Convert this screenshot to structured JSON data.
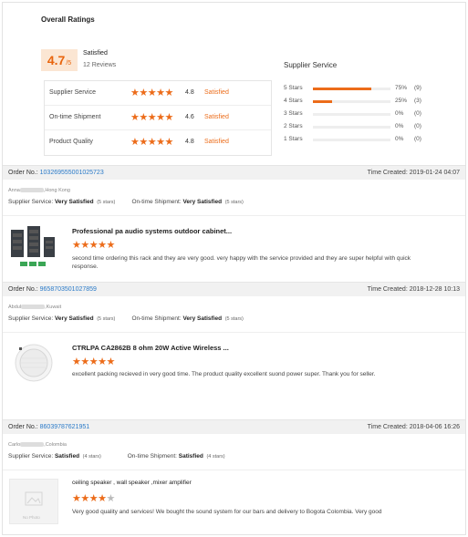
{
  "overall": {
    "title": "Overall Ratings",
    "score": "4.7",
    "score_denominator": "/5",
    "status": "Satisfied",
    "reviews": "12 Reviews"
  },
  "ratings": [
    {
      "label": "Supplier Service",
      "stars": "★★★★★",
      "score": "4.8",
      "status": "Satisfied"
    },
    {
      "label": "On-time Shipment",
      "stars": "★★★★★",
      "score": "4.6",
      "status": "Satisfied"
    },
    {
      "label": "Product Quality",
      "stars": "★★★★★",
      "score": "4.8",
      "status": "Satisfied"
    }
  ],
  "supplier_service": {
    "title": "Supplier Service",
    "rows": [
      {
        "label": "5 Stars",
        "pct_text": "75%",
        "pct": 0.75,
        "count": "(9)"
      },
      {
        "label": "4 Stars",
        "pct_text": "25%",
        "pct": 0.25,
        "count": "(3)"
      },
      {
        "label": "3 Stars",
        "pct_text": "0%",
        "pct": 0,
        "count": "(0)"
      },
      {
        "label": "2 Stars",
        "pct_text": "0%",
        "pct": 0,
        "count": "(0)"
      },
      {
        "label": "1 Stars",
        "pct_text": "0%",
        "pct": 0,
        "count": "(0)"
      }
    ]
  },
  "accent_color": "#ec6c1a",
  "link_color": "#2a7ac8",
  "orders": [
    {
      "order_label": "Order No.:",
      "order_no": "103269555001025723",
      "time_label": "Time Created:",
      "time": "2019-01-24 04:07",
      "buyer_prefix": "Anna",
      "buyer_location": "Hong Kong",
      "supplier_service_label": "Supplier Service:",
      "supplier_service_value": "Very Satisfied",
      "supplier_service_stars": "(5 stars)",
      "shipment_label": "On-time Shipment:",
      "shipment_value": "Very Satisfied",
      "shipment_stars": "(5 stars)",
      "product_name": "Professional pa audio systems outdoor cabinet...",
      "rating_stars": "★★★★★",
      "rating_off": "",
      "review": "second time ordering this rack and they are very good. very happy with the service provided and they are super helpful with quick response."
    },
    {
      "order_label": "Order No.:",
      "order_no": "96587035010278​59",
      "time_label": "Time Created:",
      "time": "2018-12-28 10:13",
      "buyer_prefix": "Abdul",
      "buyer_location": "Kuwait",
      "supplier_service_label": "Supplier Service:",
      "supplier_service_value": "Very Satisfied",
      "supplier_service_stars": "(5 stars)",
      "shipment_label": "On-time Shipment:",
      "shipment_value": "Very Satisfied",
      "shipment_stars": "(5 stars)",
      "product_name": "CTRLPA CA2862B 8 ohm 20W Active Wireless ...",
      "rating_stars": "★★★★★",
      "rating_off": "",
      "review": "excellent packing recieved in very good time. The product quality excellent suond power super. Thank you for seller."
    },
    {
      "order_label": "Order No.:",
      "order_no": "86039787621951",
      "time_label": "Time Created:",
      "time": "2018-04-06 16:26",
      "buyer_prefix": "Carlo",
      "buyer_location": "Colombia",
      "supplier_service_label": "Supplier Service:",
      "supplier_service_value": "Satisfied",
      "supplier_service_stars": "(4 stars)",
      "shipment_label": "On-time Shipment:",
      "shipment_value": "Satisfied",
      "shipment_stars": "(4 stars)",
      "product_name": "ceiling speaker , wall speaker ,mixer amplifier",
      "rating_stars": "★★★★",
      "rating_off": "★",
      "review": "Very good quality and services! We bought the sound system for our bars and delivery to Bogota Colombia. Very good",
      "no_photo_label": "No Photo"
    }
  ]
}
